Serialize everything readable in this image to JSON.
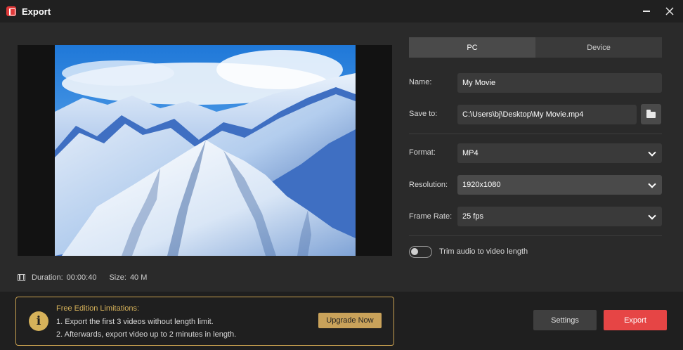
{
  "window": {
    "title": "Export",
    "app_icon": "app-logo-icon",
    "minimize_icon": "minimize-icon",
    "close_icon": "close-icon"
  },
  "preview": {
    "image_description_icon": "mountain-landscape-image",
    "duration_label": "Duration:",
    "duration_value": "00:00:40",
    "size_label": "Size:",
    "size_value": "40 M"
  },
  "tabs": [
    {
      "label": "PC",
      "active": true
    },
    {
      "label": "Device",
      "active": false
    }
  ],
  "form": {
    "name_label": "Name:",
    "name_value": "My Movie",
    "save_label": "Save to:",
    "save_value": "C:\\Users\\bj\\Desktop\\My Movie.mp4",
    "format_label": "Format:",
    "format_value": "MP4",
    "resolution_label": "Resolution:",
    "resolution_value": "1920x1080",
    "framerate_label": "Frame Rate:",
    "framerate_value": "25 fps",
    "trim_label": "Trim audio to video length",
    "trim_enabled": false
  },
  "notice": {
    "title": "Free Edition Limitations:",
    "line1": "1. Export the first 3 videos without length limit.",
    "line2": "2. Afterwards, export video up to 2 minutes in length.",
    "upgrade_label": "Upgrade Now"
  },
  "actions": {
    "settings_label": "Settings",
    "export_label": "Export"
  },
  "colors": {
    "accent": "#e64545",
    "warning": "#d6b25a",
    "background": "#2a2a2a"
  }
}
